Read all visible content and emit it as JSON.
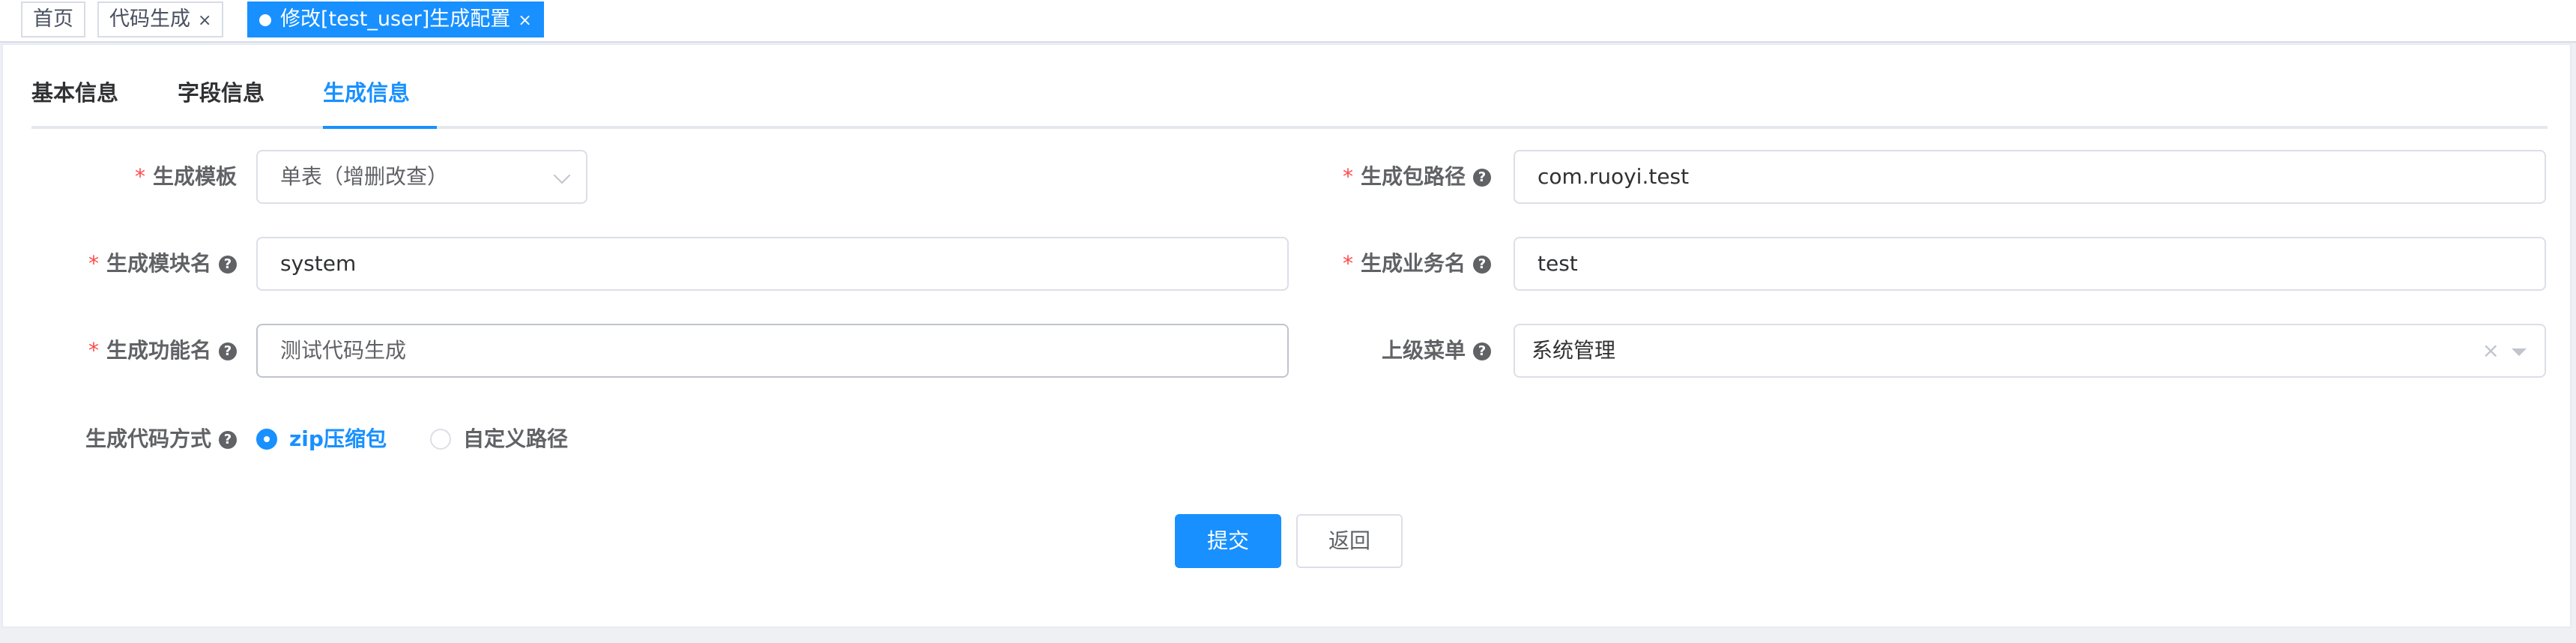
{
  "tags": [
    {
      "label": "首页",
      "closable": false
    },
    {
      "label": "代码生成",
      "closable": true
    },
    {
      "label": "修改[test_user]生成配置",
      "closable": true,
      "active": true
    }
  ],
  "tag_close_glyph": "×",
  "form_tabs": [
    "基本信息",
    "字段信息",
    "生成信息"
  ],
  "active_tab": "生成信息",
  "form": {
    "tpl_category": {
      "label": "生成模板",
      "value": "单表（增删改查）"
    },
    "package_name": {
      "label": "生成包路径",
      "value": "com.ruoyi.test"
    },
    "module_name": {
      "label": "生成模块名",
      "value": "system"
    },
    "business_name": {
      "label": "生成业务名",
      "value": "test"
    },
    "function_name": {
      "label": "生成功能名",
      "value": "测试代码生成"
    },
    "parent_menu": {
      "label": "上级菜单",
      "value": "系统管理",
      "clear_glyph": "×"
    },
    "gen_type": {
      "label": "生成代码方式",
      "options": [
        "zip压缩包",
        "自定义路径"
      ],
      "selected": "zip压缩包"
    }
  },
  "required_mark": "*",
  "help_glyph": "?",
  "buttons": {
    "submit": "提交",
    "back": "返回"
  },
  "colors": {
    "primary": "#1890ff",
    "required": "#ff4949",
    "border": "#dcdfe6"
  },
  "icons": [
    "question-circle-icon",
    "chevron-down-icon",
    "caret-down-icon",
    "close-icon",
    "dot-icon"
  ]
}
